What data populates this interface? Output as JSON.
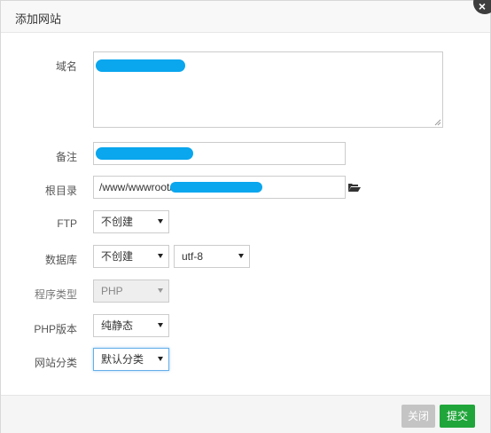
{
  "dialog": {
    "title": "添加网站",
    "close_icon": "close-icon"
  },
  "form": {
    "domain": {
      "label": "域名",
      "value": ""
    },
    "remark": {
      "label": "备注",
      "value": ""
    },
    "root_dir": {
      "label": "根目录",
      "value": "/www/wwwroot/",
      "icon": "folder-open-icon"
    },
    "ftp": {
      "label": "FTP",
      "selected": "不创建"
    },
    "database": {
      "label": "数据库",
      "selected": "不创建",
      "charset": "utf-8"
    },
    "program_type": {
      "label": "程序类型",
      "selected": "PHP"
    },
    "php_version": {
      "label": "PHP版本",
      "selected": "纯静态"
    },
    "category": {
      "label": "网站分类",
      "selected": "默认分类"
    }
  },
  "footer": {
    "close_label": "关闭",
    "submit_label": "提交"
  },
  "colors": {
    "accent_green": "#20a53a",
    "redaction_blue": "#0aa6ee",
    "focus_blue": "#66afe9"
  }
}
